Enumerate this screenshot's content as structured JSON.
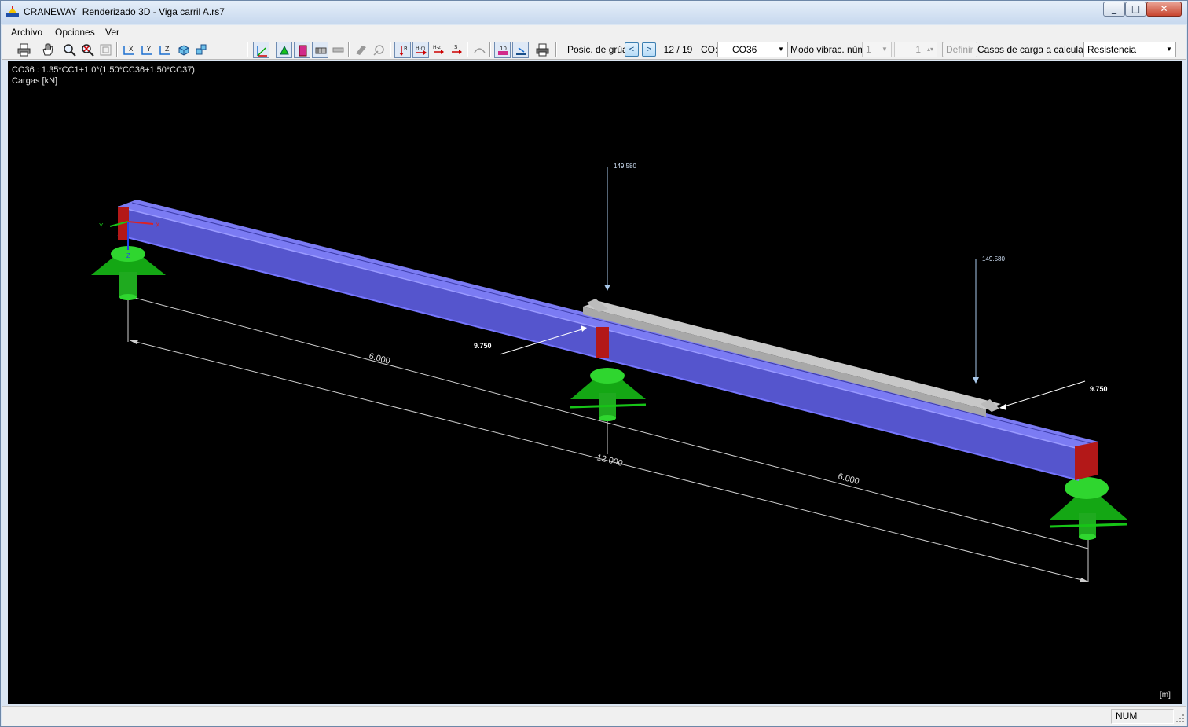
{
  "window": {
    "app_name": "CRANEWAY",
    "title": "Renderizado 3D - Viga carril A.rs7",
    "controls": [
      "minimize-icon",
      "maximize-icon",
      "close-icon"
    ]
  },
  "menu": [
    "Archivo",
    "Opciones",
    "Ver"
  ],
  "toolbar": {
    "icons": [
      "print-icon",
      "pan-hand-icon",
      "zoom-icon",
      "zoom-all-icon",
      "view-frame-icon",
      "view-x-icon",
      "view-y-icon",
      "view-z-icon",
      "isometric-view-icon",
      "axes-icon",
      "model-icon",
      "support-icon",
      "section-icon",
      "render-icon",
      "member-icon",
      "load-icon",
      "values-icon",
      "rail-icon",
      "reactions-icon",
      "hm-icon",
      "hz-icon",
      "s-icon",
      "deformation-icon",
      "numbers-icon",
      "cross-section-icon",
      "print-graphic-icon"
    ],
    "crane_position_label": "Posic. de grúa:",
    "crane_position": "12 / 19",
    "co_label": "CO:",
    "co_value": "CO36",
    "vibration_label": "Modo vibrac. núm.",
    "vibration_value": "1",
    "vibration_spin_value": "1",
    "define_label": "Definir",
    "load_cases_label": "Casos de carga a calcular:",
    "load_cases_value": "Resistencia"
  },
  "viewport": {
    "combination_info": "CO36 : 1.35*CC1+1.0*(1.50*CC36+1.50*CC37)",
    "loads_unit": "Cargas [kN]",
    "units_label": "[m]",
    "axis_labels": {
      "x": "X",
      "y": "Y",
      "z": "Z"
    },
    "vertical_loads": [
      "149.580",
      "149.580"
    ],
    "horizontal_loads": [
      "9.750",
      "9.750"
    ],
    "dimensions": {
      "span_left": "6.000",
      "span_right": "6.000",
      "total": "12.000"
    },
    "colors": {
      "beam": "#5a5ad8",
      "rail": "#a8a8a8",
      "support": "#17c417",
      "end_plate": "#b31818",
      "load_arrow": "#a9c8ea"
    }
  },
  "status": {
    "num": "NUM"
  }
}
